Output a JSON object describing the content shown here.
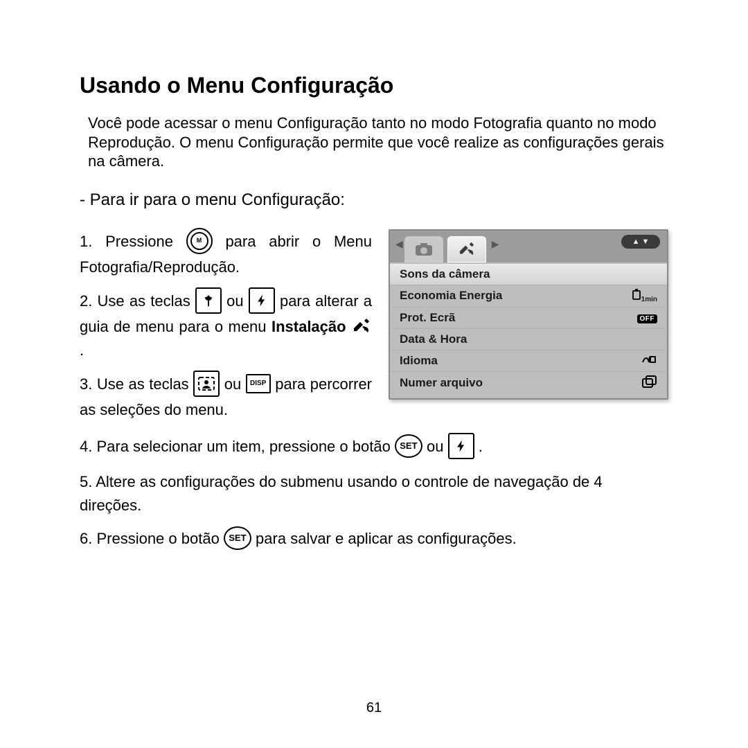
{
  "title": "Usando o Menu Configuração",
  "intro": "Você pode acessar o menu Configuração tanto no modo Fotografia quanto no modo Reprodução. O menu Configuração permite que você realize as configurações gerais na câmera.",
  "subhead": "-  Para ir para o menu Configuração:",
  "steps": {
    "s1a": "1. Pressione ",
    "s1b": " para abrir o Menu Fotografia/Reprodução.",
    "s2a": "2. Use as teclas ",
    "s2b": " ou ",
    "s2c": " para alterar a guia de menu para o menu ",
    "s2d_bold": "Instalação ",
    "s2e": " .",
    "s3a": "3. Use as teclas ",
    "s3b": " ou ",
    "s3c": " para percorrer as seleções do menu.",
    "s4a": "4. Para selecionar um item, pressione o botão ",
    "s4b": " ou ",
    "s4c": " .",
    "s5": "5. Altere as configurações do submenu usando o controle de navegação de 4 direções.",
    "s6a": "6. Pressione o botão ",
    "s6b": " para salvar e aplicar as configurações."
  },
  "icons": {
    "menu": "M",
    "macro": "flower",
    "flash": "bolt",
    "face": "face",
    "disp": "DISP",
    "set": "SET",
    "wrench": "wrench"
  },
  "screen": {
    "tabs_scroll": "▲ ▼",
    "items": [
      {
        "label": "Sons da câmera",
        "value": ""
      },
      {
        "label": "Economia Energia",
        "value": "1min",
        "value_icon": "battery"
      },
      {
        "label": "Prot. Ecrã",
        "value": "OFF",
        "value_style": "off"
      },
      {
        "label": "Data & Hora",
        "value": ""
      },
      {
        "label": "Idioma",
        "value": "",
        "value_icon": "lang"
      },
      {
        "label": "Numer arquivo",
        "value": "",
        "value_icon": "copy"
      }
    ]
  },
  "page_number": "61"
}
